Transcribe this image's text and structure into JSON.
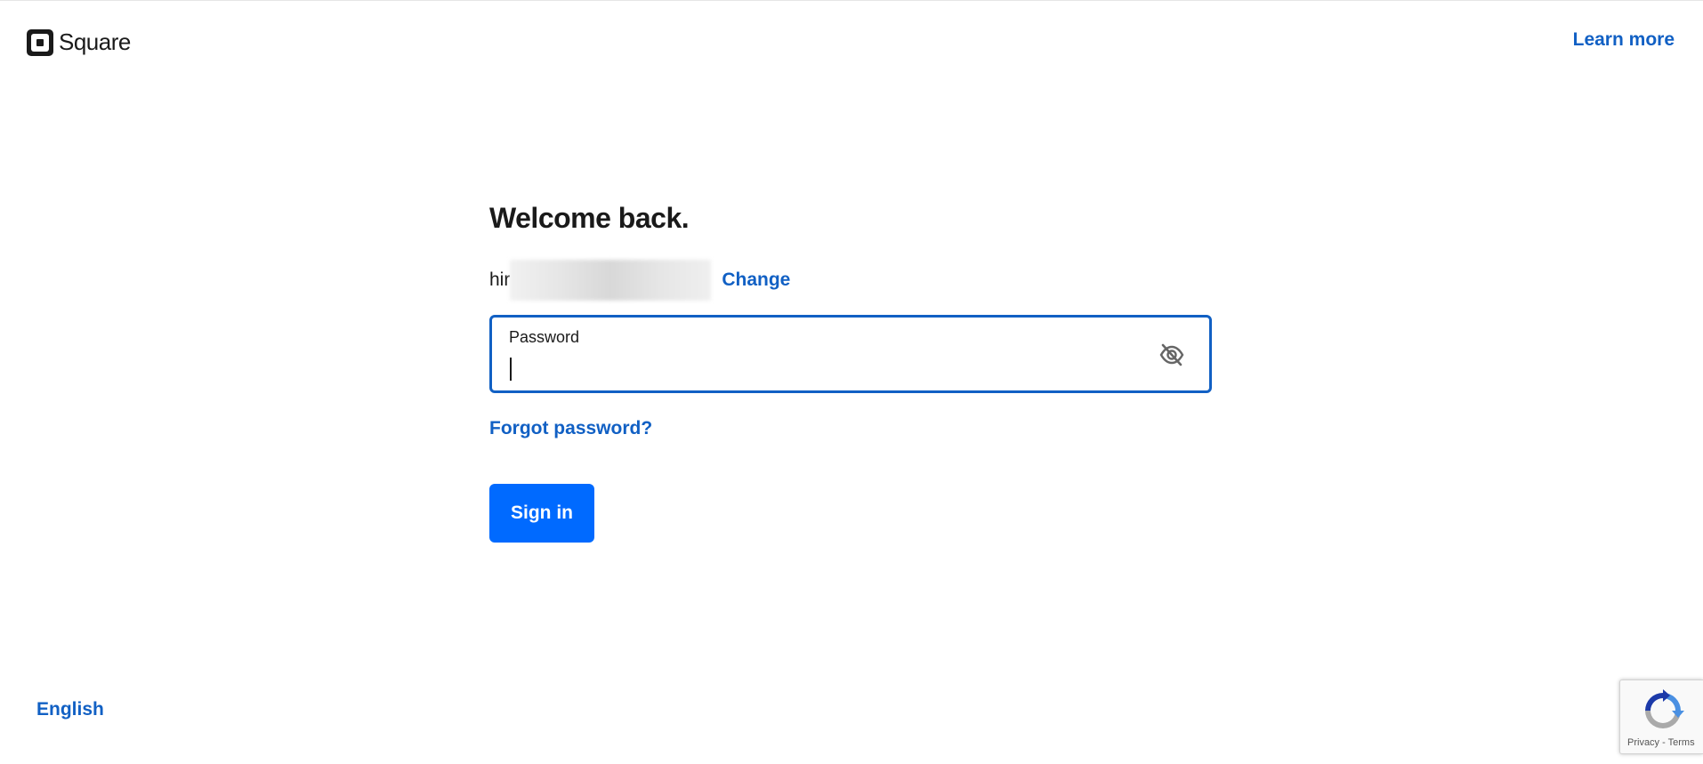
{
  "header": {
    "logo_text": "Square",
    "learn_more": "Learn more"
  },
  "form": {
    "title": "Welcome back.",
    "email_visible": "hir",
    "change_link": "Change",
    "password_label": "Password",
    "password_value": "",
    "forgot_password": "Forgot password?",
    "sign_in": "Sign in"
  },
  "footer": {
    "language": "English"
  },
  "recaptcha": {
    "privacy": "Privacy",
    "separator": "-",
    "terms": "Terms"
  },
  "colors": {
    "accent": "#006aff",
    "link": "#1160c4",
    "text": "#1a1a1a"
  },
  "icons": [
    "square-logo-icon",
    "eye-off-icon",
    "recaptcha-icon"
  ]
}
